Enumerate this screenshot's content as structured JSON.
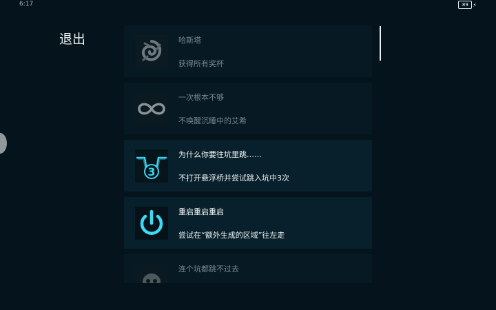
{
  "status": {
    "time": "6:17",
    "battery": "89"
  },
  "header": {
    "exit_label": "退出"
  },
  "achievements": [
    {
      "title": "哈斯塔",
      "desc": "获得所有奖杯",
      "icon": "swirl-icon",
      "unlocked": false
    },
    {
      "title": "一次根本不够",
      "desc": "不唤醒沉睡中的艾希",
      "icon": "infinity-icon",
      "unlocked": false
    },
    {
      "title": "为什么你要往坑里跳……",
      "desc": "不打开悬浮桥并尝试跳入坑中3次",
      "icon": "pit-three-icon",
      "badge": "3",
      "unlocked": true
    },
    {
      "title": "重启重启重启",
      "desc": "尝试在“额外生成的区域”往左走",
      "icon": "power-icon",
      "unlocked": true
    },
    {
      "title": "连个坑都跳不过去",
      "desc": "",
      "icon": "skull-icon",
      "unlocked": false
    }
  ],
  "colors": {
    "accent": "#38d6f0",
    "background": "#05141c",
    "card": "#08202b"
  }
}
